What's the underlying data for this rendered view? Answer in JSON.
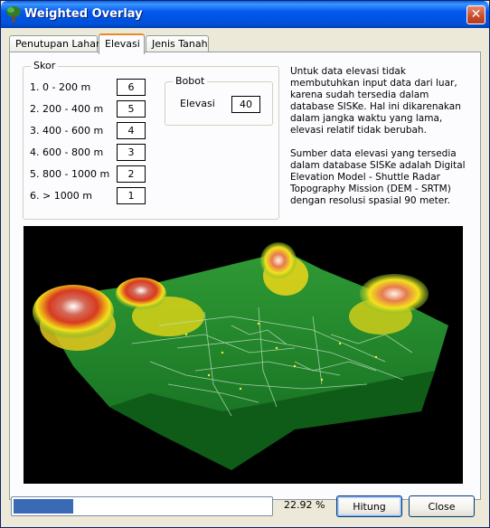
{
  "window": {
    "title": "Weighted Overlay",
    "close_glyph": "✕",
    "icon": "tree-icon"
  },
  "tabs": [
    {
      "label": "Penutupan Lahan",
      "active": false
    },
    {
      "label": "Elevasi",
      "active": true
    },
    {
      "label": "Jenis Tanah",
      "active": false
    }
  ],
  "skor": {
    "legend": "Skor",
    "rows": [
      {
        "label": "1. 0 - 200 m",
        "value": "6"
      },
      {
        "label": "2. 200 - 400 m",
        "value": "5"
      },
      {
        "label": "3. 400 - 600 m",
        "value": "4"
      },
      {
        "label": "4. 600 - 800 m",
        "value": "3"
      },
      {
        "label": "5. 800 - 1000 m",
        "value": "2"
      },
      {
        "label": "6. > 1000 m",
        "value": "1"
      }
    ]
  },
  "bobot": {
    "legend": "Bobot",
    "label": "Elevasi",
    "value": "40"
  },
  "info": {
    "paragraph1": "Untuk data elevasi tidak membutuhkan input data dari luar, karena sudah tersedia dalam database SISKe. Hal ini dikarenakan dalam jangka waktu yang lama, elevasi relatif tidak berubah.",
    "paragraph2": "Sumber data elevasi yang tersedia dalam database SISKe adalah Digital Elevation Model - Shuttle Radar Topography Mission (DEM - SRTM) dengan resolusi spasial 90 meter."
  },
  "progress": {
    "fraction": 0.2292,
    "text": "22.92 %"
  },
  "buttons": {
    "hitung": "Hitung",
    "close": "Close"
  },
  "colors": {
    "titlebar": "#0058ee",
    "progress_fill": "#3a6ab5",
    "terrain_low": "#1f8a2c",
    "terrain_mid": "#f2e51a",
    "terrain_high": "#cc2e1e"
  }
}
